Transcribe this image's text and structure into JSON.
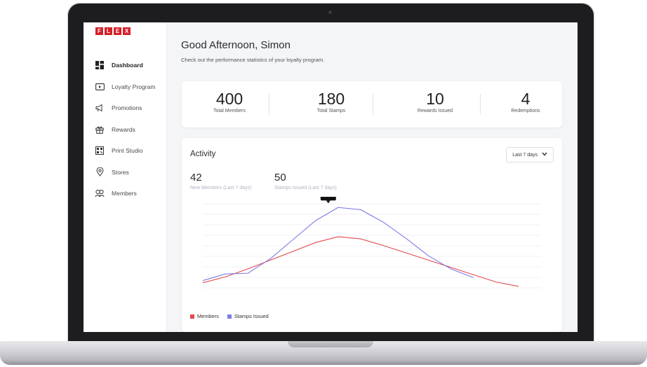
{
  "brand": {
    "letters": [
      "F",
      "L",
      "E",
      "X"
    ],
    "color": "#d4202a"
  },
  "sidebar": {
    "items": [
      {
        "label": "Dashboard",
        "icon": "dashboard-icon",
        "active": true
      },
      {
        "label": "Loyalty Program",
        "icon": "loyalty-card-icon",
        "active": false
      },
      {
        "label": "Promotions",
        "icon": "megaphone-icon",
        "active": false
      },
      {
        "label": "Rewards",
        "icon": "gift-icon",
        "active": false
      },
      {
        "label": "Print Studio",
        "icon": "qr-code-icon",
        "active": false
      },
      {
        "label": "Stores",
        "icon": "location-pin-icon",
        "active": false
      },
      {
        "label": "Members",
        "icon": "members-icon",
        "active": false
      }
    ]
  },
  "header": {
    "greeting": "Good Afternoon, Simon",
    "subtitle": "Check out the performance statistics of your loyalty program."
  },
  "stats": [
    {
      "value": "400",
      "label": "Total Members"
    },
    {
      "value": "180",
      "label": "Total Stamps"
    },
    {
      "value": "10",
      "label": "Rewards Issued"
    },
    {
      "value": "4",
      "label": "Redemptions"
    }
  ],
  "activity": {
    "title": "Activity",
    "range_select": {
      "selected": "Last 7 days",
      "icon": "chevron-down-icon"
    },
    "metrics": [
      {
        "value": "42",
        "label": "New Members (Last 7 days)"
      },
      {
        "value": "50",
        "label": "Stamps Issued (Last 7 days)"
      }
    ]
  },
  "chart_data": {
    "type": "line",
    "x": [
      0,
      1,
      2,
      3,
      4,
      5,
      6,
      7,
      8,
      9,
      10,
      11,
      12,
      13,
      14,
      15
    ],
    "series": [
      {
        "name": "Members",
        "color": "#e5484d",
        "values": [
          -0.3,
          0.5,
          1.6,
          2.8,
          4.0,
          5.2,
          6.0,
          5.7,
          4.8,
          3.8,
          2.8,
          1.8,
          0.8,
          -0.2,
          -0.8
        ]
      },
      {
        "name": "Stamps Issued",
        "color": "#7b7be8",
        "values": [
          0,
          0.9,
          1.0,
          3.0,
          5.6,
          8.2,
          10.0,
          9.7,
          8.0,
          5.8,
          3.4,
          1.6,
          0.4
        ]
      }
    ],
    "tooltip": {
      "value": "10"
    },
    "ylim": [
      -1,
      10.5
    ],
    "grid": true,
    "legend": "bottom-left"
  }
}
